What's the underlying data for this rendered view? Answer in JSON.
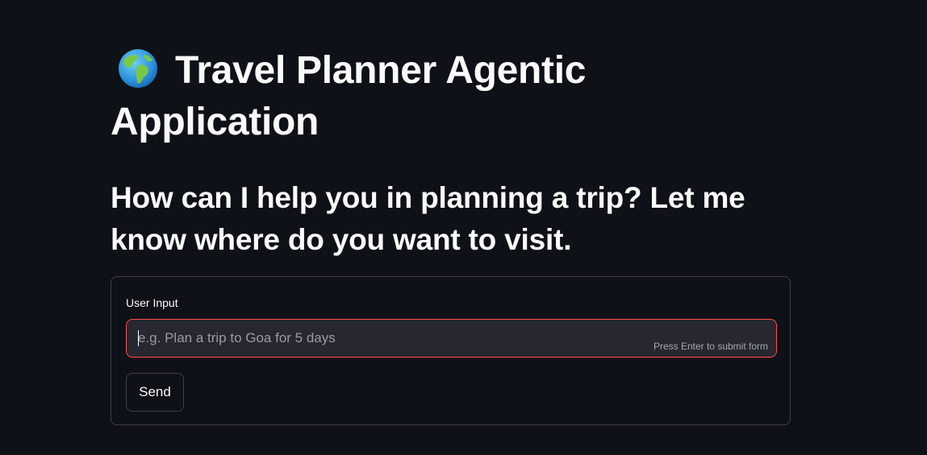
{
  "page": {
    "title_icon": "globe-icon",
    "title": "Travel Planner Agentic Application",
    "subtitle": "How can I help you in planning a trip? Let me know where do you want to visit."
  },
  "form": {
    "input_label": "User Input",
    "input_value": "",
    "input_placeholder": "e.g. Plan a trip to Goa for 5 days",
    "submit_hint": "Press Enter to submit form",
    "send_label": "Send"
  },
  "colors": {
    "background": "#0e1117",
    "text": "#fafafa",
    "input_background": "#262730",
    "focus_border": "#ff4b4b"
  }
}
